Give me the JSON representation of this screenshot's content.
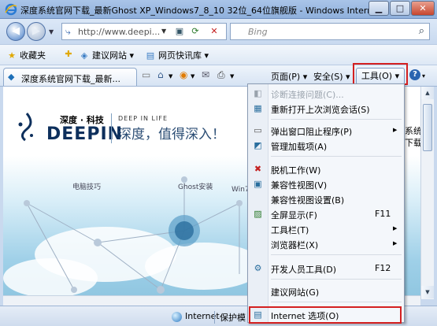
{
  "window": {
    "title": "深度系统官网下载_最新Ghost XP_Windows7_8_10 32位_64位旗舰版 - Windows Internet Explorer",
    "minimize_label": "▁",
    "maximize_label": "□",
    "close_label": "✕"
  },
  "address_bar": {
    "url": "http://www.deepi...",
    "search_placeholder": "Bing"
  },
  "favorites_bar": {
    "favorites_label": "收藏夹",
    "items": [
      "建议网站 ▾",
      "网页快讯库 ▾"
    ]
  },
  "command_bar": {
    "tab_title": "深度系统官网下载_最新...",
    "page_label": "页面(P) ▾",
    "safety_label": "安全(S) ▾",
    "tools_label": "工具(O) ▾",
    "help_label": "▾"
  },
  "page": {
    "brand_cn": "深度 · 科技",
    "brand_en": "DEEPIN",
    "tagline_en": "DEEP IN LIFE",
    "slogan": "深度，值得深入！",
    "categories": [
      "电脑技巧",
      "Ghost安装",
      "Win7"
    ],
    "right_edge_lines": [
      "系统",
      "下载"
    ]
  },
  "tools_menu": {
    "items": [
      {
        "label": "诊断连接问题(C)...",
        "key": "",
        "submenu": false,
        "disabled": true,
        "icon": "diagnose-icon"
      },
      {
        "label": "重新打开上次浏览会话(S)",
        "key": "",
        "submenu": false,
        "disabled": false,
        "icon": "reopen-session-icon"
      },
      {
        "label": "弹出窗口阻止程序(P)",
        "key": "",
        "submenu": true,
        "disabled": false,
        "icon": "popup-blocker-icon"
      },
      {
        "label": "管理加载项(A)",
        "key": "",
        "submenu": false,
        "disabled": false,
        "icon": "addons-icon"
      },
      {
        "label": "脱机工作(W)",
        "key": "",
        "submenu": false,
        "disabled": false,
        "icon": "offline-icon"
      },
      {
        "label": "兼容性视图(V)",
        "key": "",
        "submenu": false,
        "disabled": false,
        "icon": "compat-view-icon"
      },
      {
        "label": "兼容性视图设置(B)",
        "key": "",
        "submenu": false,
        "disabled": false,
        "icon": ""
      },
      {
        "label": "全屏显示(F)",
        "key": "F11",
        "submenu": false,
        "disabled": false,
        "icon": "fullscreen-icon"
      },
      {
        "label": "工具栏(T)",
        "key": "",
        "submenu": true,
        "disabled": false,
        "icon": ""
      },
      {
        "label": "浏览器栏(X)",
        "key": "",
        "submenu": true,
        "disabled": false,
        "icon": ""
      },
      {
        "label": "开发人员工具(D)",
        "key": "F12",
        "submenu": false,
        "disabled": false,
        "icon": "dev-tools-icon"
      },
      {
        "label": "建议网站(G)",
        "key": "",
        "submenu": false,
        "disabled": false,
        "icon": ""
      },
      {
        "label": "Internet 选项(O)",
        "key": "",
        "submenu": false,
        "disabled": false,
        "icon": "internet-options-icon"
      }
    ]
  },
  "status_bar": {
    "zone": "Internet",
    "protected_mode": "保护模"
  },
  "colors": {
    "highlight_box": "#d42020",
    "brand_navy": "#0d2f5c"
  }
}
